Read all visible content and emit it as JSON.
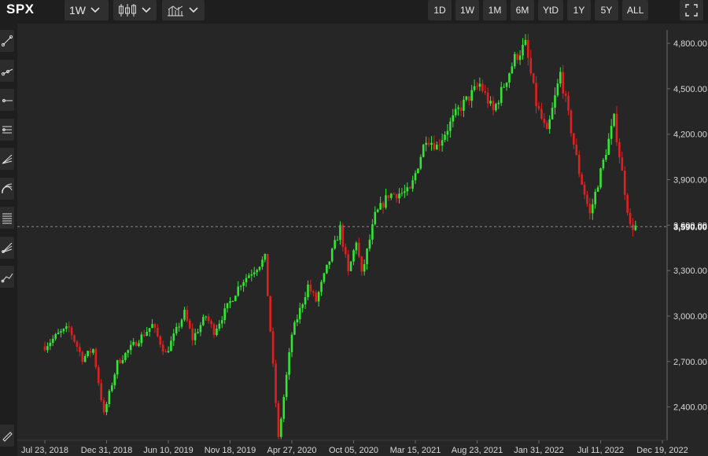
{
  "header": {
    "symbol": "SPX",
    "interval": "1W",
    "chart_type_icon": "candlestick-icon",
    "indicators_icon": "indicators-icon",
    "ranges": [
      "1D",
      "1W",
      "1M",
      "6M",
      "YtD",
      "1Y",
      "5Y",
      "ALL"
    ],
    "fullscreen_icon": "fullscreen-icon"
  },
  "toolbar": {
    "tools": [
      "trend-line-icon",
      "ray-icon",
      "horizontal-ray-icon",
      "parallel-channel-icon",
      "fib-fan-icon",
      "fib-arc-icon",
      "fib-retracement-icon",
      "pitchfork-icon",
      "path-icon"
    ],
    "bottom_tool": "brush-icon"
  },
  "colors": {
    "up": "#33e633",
    "down": "#e02020",
    "background": "#262626",
    "grid": "#2f2f2f",
    "axis_text": "#d8d8d8",
    "last_price_line": "#8a8a8a"
  },
  "chart_data": {
    "type": "candlestick",
    "interval": "1W",
    "x_ticks": [
      "Jul 23, 2018",
      "Dec 31, 2018",
      "Jun 10, 2019",
      "Nov 18, 2019",
      "Apr 27, 2020",
      "Oct 05, 2020",
      "Mar 15, 2021",
      "Aug 23, 2021",
      "Jan 31, 2022",
      "Jul 11, 2022",
      "Dec 19, 2022"
    ],
    "y_ticks": [
      {
        "value": 2400,
        "label": "2,400.00"
      },
      {
        "value": 2700,
        "label": "2,700.00"
      },
      {
        "value": 3000,
        "label": "3,000.00"
      },
      {
        "value": 3300,
        "label": "3,300.00"
      },
      {
        "value": 3600,
        "label": "3,600.00"
      },
      {
        "value": 3900,
        "label": "3,900.00"
      },
      {
        "value": 4200,
        "label": "4,200.00"
      },
      {
        "value": 4500,
        "label": "4,500.00"
      },
      {
        "value": 4800,
        "label": "4,800.00"
      }
    ],
    "ylim": [
      2180,
      4930
    ],
    "last_price": 3590,
    "last_price_label": "3,590.00",
    "grid": false,
    "series_path": [
      [
        "Jul 23, 2018",
        2800
      ],
      [
        "Aug 27, 2018",
        2880
      ],
      [
        "Sep 24, 2018",
        2920
      ],
      [
        "Oct 29, 2018",
        2720
      ],
      [
        "Nov 26, 2018",
        2780
      ],
      [
        "Dec 24, 2018",
        2350
      ],
      [
        "Jan 28, 2019",
        2690
      ],
      [
        "Mar 04, 2019",
        2790
      ],
      [
        "Apr 29, 2019",
        2940
      ],
      [
        "Jun 03, 2019",
        2750
      ],
      [
        "Jul 22, 2019",
        3020
      ],
      [
        "Aug 12, 2019",
        2850
      ],
      [
        "Sep 16, 2019",
        3000
      ],
      [
        "Oct 07, 2019",
        2900
      ],
      [
        "Dec 16, 2019",
        3220
      ],
      [
        "Feb 17, 2020",
        3380
      ],
      [
        "Mar 23, 2020",
        2190
      ],
      [
        "Apr 27, 2020",
        2880
      ],
      [
        "Jun 08, 2020",
        3200
      ],
      [
        "Jun 29, 2020",
        3100
      ],
      [
        "Aug 31, 2020",
        3580
      ],
      [
        "Sep 21, 2020",
        3280
      ],
      [
        "Oct 12, 2020",
        3500
      ],
      [
        "Oct 26, 2020",
        3270
      ],
      [
        "Nov 30, 2020",
        3660
      ],
      [
        "Jan 04, 2021",
        3800
      ],
      [
        "Mar 01, 2021",
        3820
      ],
      [
        "Apr 12, 2021",
        4180
      ],
      [
        "May 10, 2021",
        4120
      ],
      [
        "Jul 05, 2021",
        4360
      ],
      [
        "Aug 30, 2021",
        4530
      ],
      [
        "Oct 04, 2021",
        4350
      ],
      [
        "Nov 29, 2021",
        4700
      ],
      [
        "Dec 27, 2021",
        4790
      ],
      [
        "Jan 24, 2022",
        4400
      ],
      [
        "Feb 21, 2022",
        4200
      ],
      [
        "Mar 28, 2022",
        4600
      ],
      [
        "May 16, 2022",
        3950
      ],
      [
        "Jun 13, 2022",
        3670
      ],
      [
        "Aug 15, 2022",
        4300
      ],
      [
        "Sep 26, 2022",
        3590
      ],
      [
        "Oct 10, 2022",
        3590
      ]
    ]
  }
}
